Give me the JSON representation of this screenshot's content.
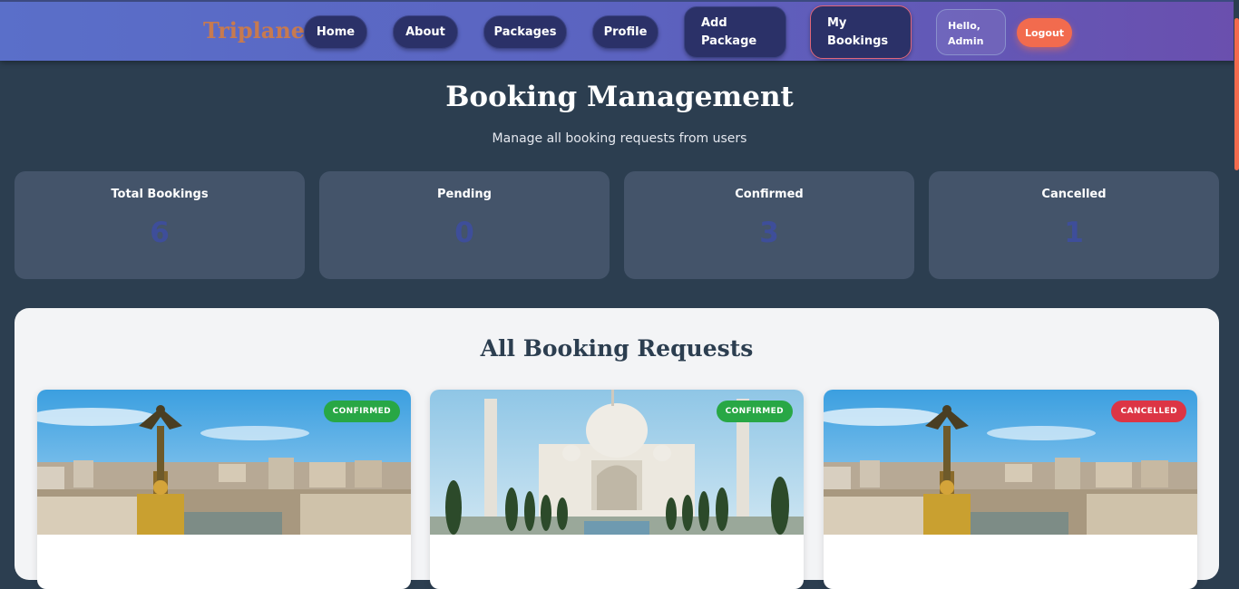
{
  "nav": {
    "brand": "Triplane",
    "items": [
      "Home",
      "About",
      "Packages",
      "Profile"
    ],
    "add_package": [
      "Add",
      "Package"
    ],
    "my_bookings": [
      "My",
      "Bookings"
    ],
    "greeting": [
      "Hello,",
      "Admin"
    ],
    "logout": "Logout"
  },
  "header": {
    "title": "Booking Management",
    "subtitle": "Manage all booking requests from users"
  },
  "stats": [
    {
      "label": "Total Bookings",
      "value": "6"
    },
    {
      "label": "Pending",
      "value": "0"
    },
    {
      "label": "Confirmed",
      "value": "3"
    },
    {
      "label": "Cancelled",
      "value": "1"
    }
  ],
  "bookings": {
    "title": "All Booking Requests",
    "cards": [
      {
        "status": "CONFIRMED",
        "status_color": "#28a745",
        "image": "city-monument"
      },
      {
        "status": "CONFIRMED",
        "status_color": "#28a745",
        "image": "taj-mahal"
      },
      {
        "status": "CANCELLED",
        "status_color": "#dc3545",
        "image": "city-monument"
      }
    ]
  },
  "colors": {
    "accent": "#f26b4e",
    "nav_button": "#2b3168",
    "stat_value": "#3e4e9a"
  }
}
